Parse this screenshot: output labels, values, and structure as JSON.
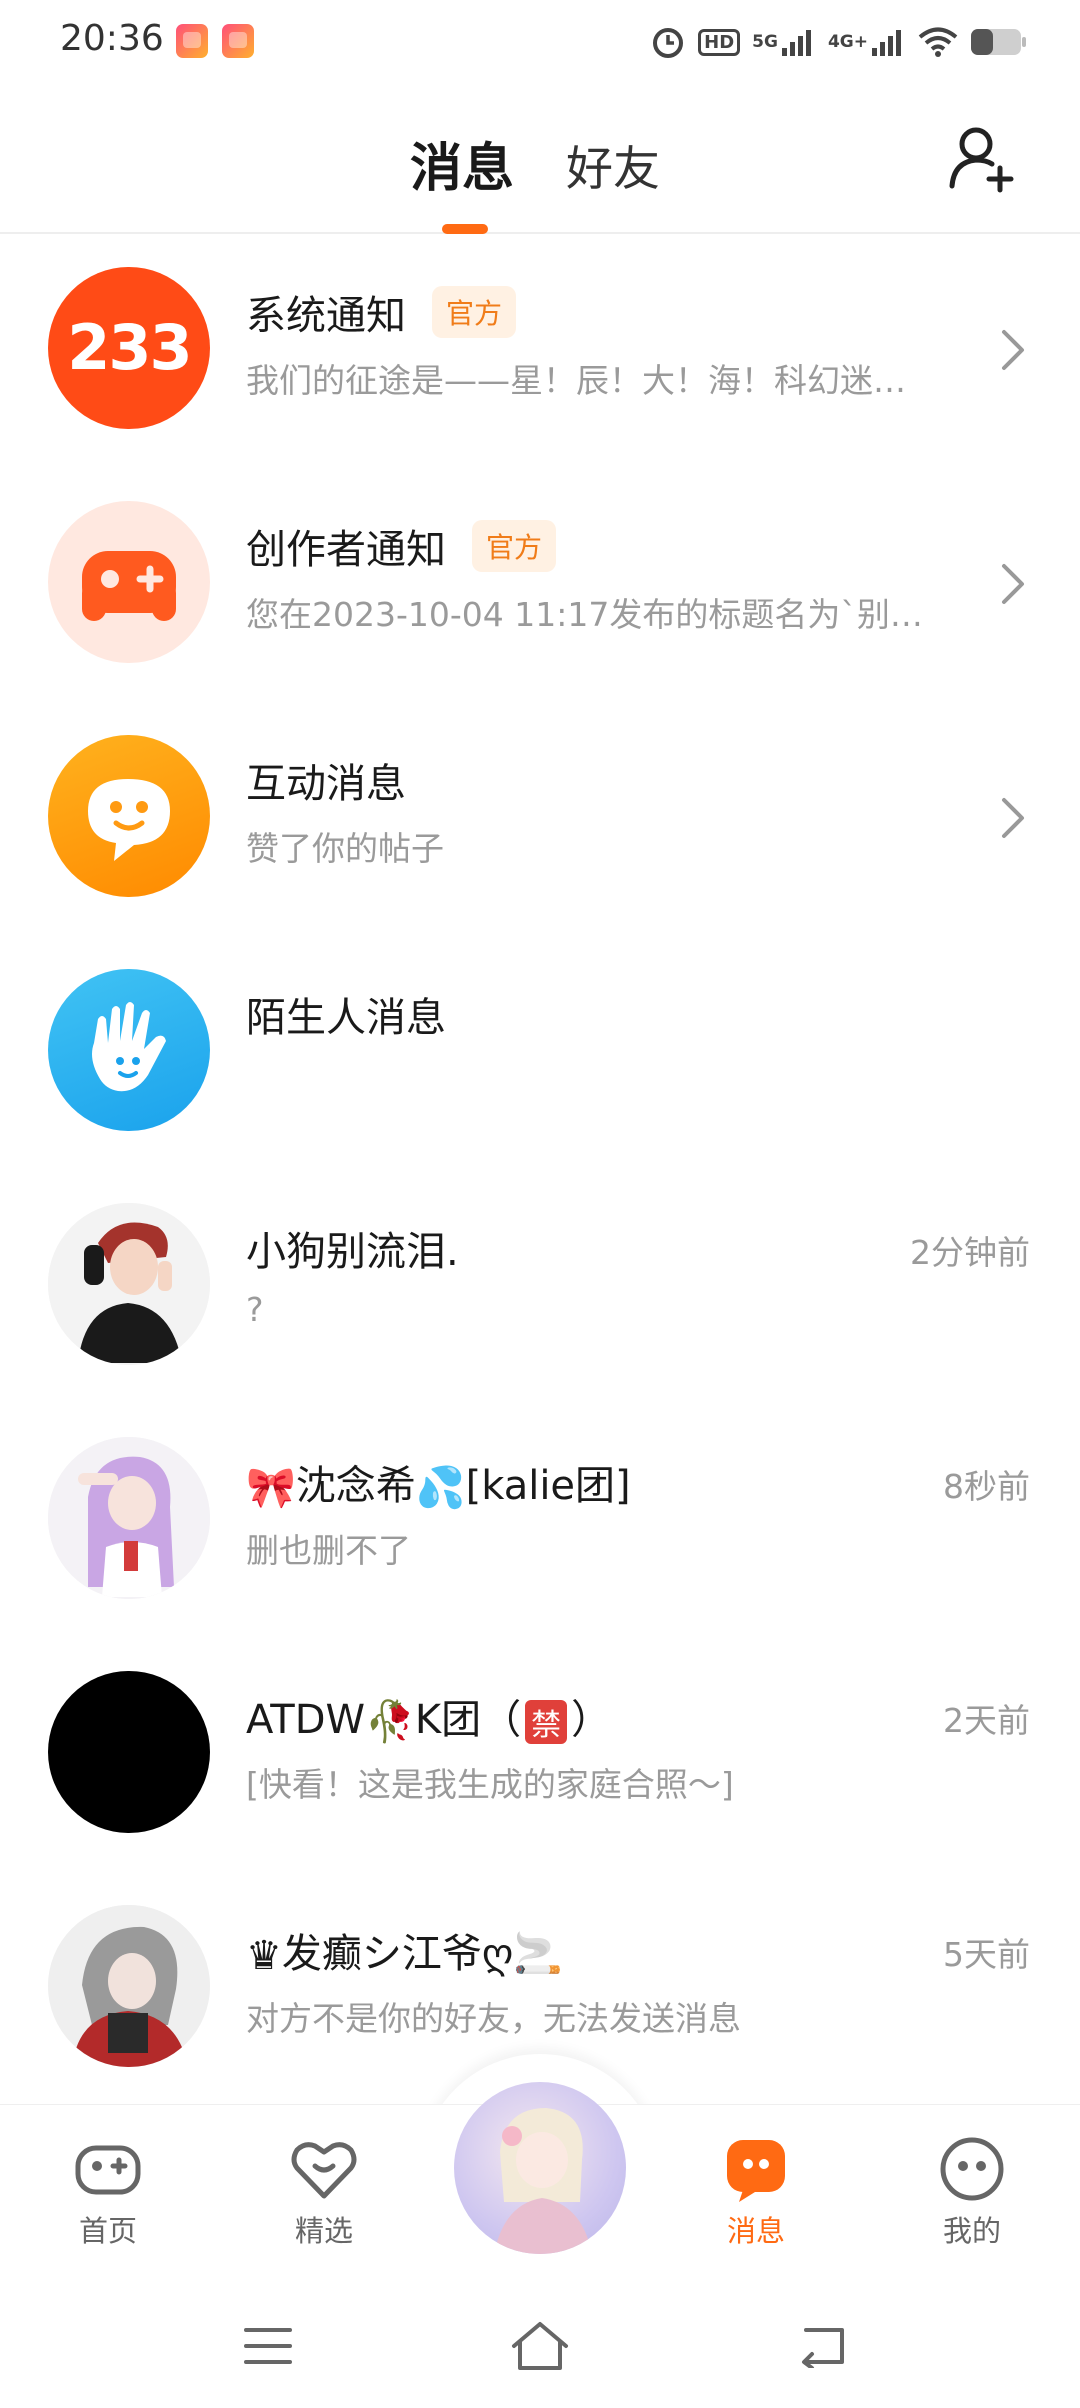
{
  "status_bar": {
    "time": "20:36",
    "hd_label": "HD",
    "net1": "5G",
    "net2": "4G+"
  },
  "header": {
    "tab_messages": "消息",
    "tab_friends": "好友"
  },
  "colors": {
    "accent": "#ff6a13",
    "badge_bg": "#fff1e3",
    "badge_text": "#f07c19"
  },
  "rows": [
    {
      "title": "系统通知",
      "badge": "官方",
      "subtitle": "我们的征途是——星！辰！大！海！科幻迷…",
      "avatar_text": "233",
      "avatar_icon": "233-logo"
    },
    {
      "title": "创作者通知",
      "badge": "官方",
      "subtitle": "您在2023-10-04 11:17发布的标题名为`别…",
      "avatar_icon": "gamepad-icon"
    },
    {
      "title": "互动消息",
      "subtitle": "赞了你的帖子",
      "avatar_icon": "chat-smile-icon"
    },
    {
      "title": "陌生人消息",
      "avatar_icon": "waving-hand-icon"
    },
    {
      "title": "小狗别流泪.",
      "subtitle": "?",
      "time": "2分钟前"
    },
    {
      "title_pre": "🎀",
      "title": "沈念希",
      "title_mid": "💦",
      "title_post": "[kalie团]",
      "subtitle": "删也删不了",
      "time": "8秒前"
    },
    {
      "title": "ATDW",
      "title_mid": "🥀",
      "title_post": "K团（",
      "title_badge": "禁",
      "title_end": "）",
      "subtitle": "[快看！这是我生成的家庭合照～]",
      "time": "2天前"
    },
    {
      "title_pre": "♛",
      "title": "发癫シ江爷",
      "title_post": "ღ🚬",
      "subtitle": "对方不是你的好友，无法发送消息",
      "time": "5天前"
    }
  ],
  "bottom_nav": {
    "home": "首页",
    "featured": "精选",
    "messages": "消息",
    "me": "我的"
  }
}
